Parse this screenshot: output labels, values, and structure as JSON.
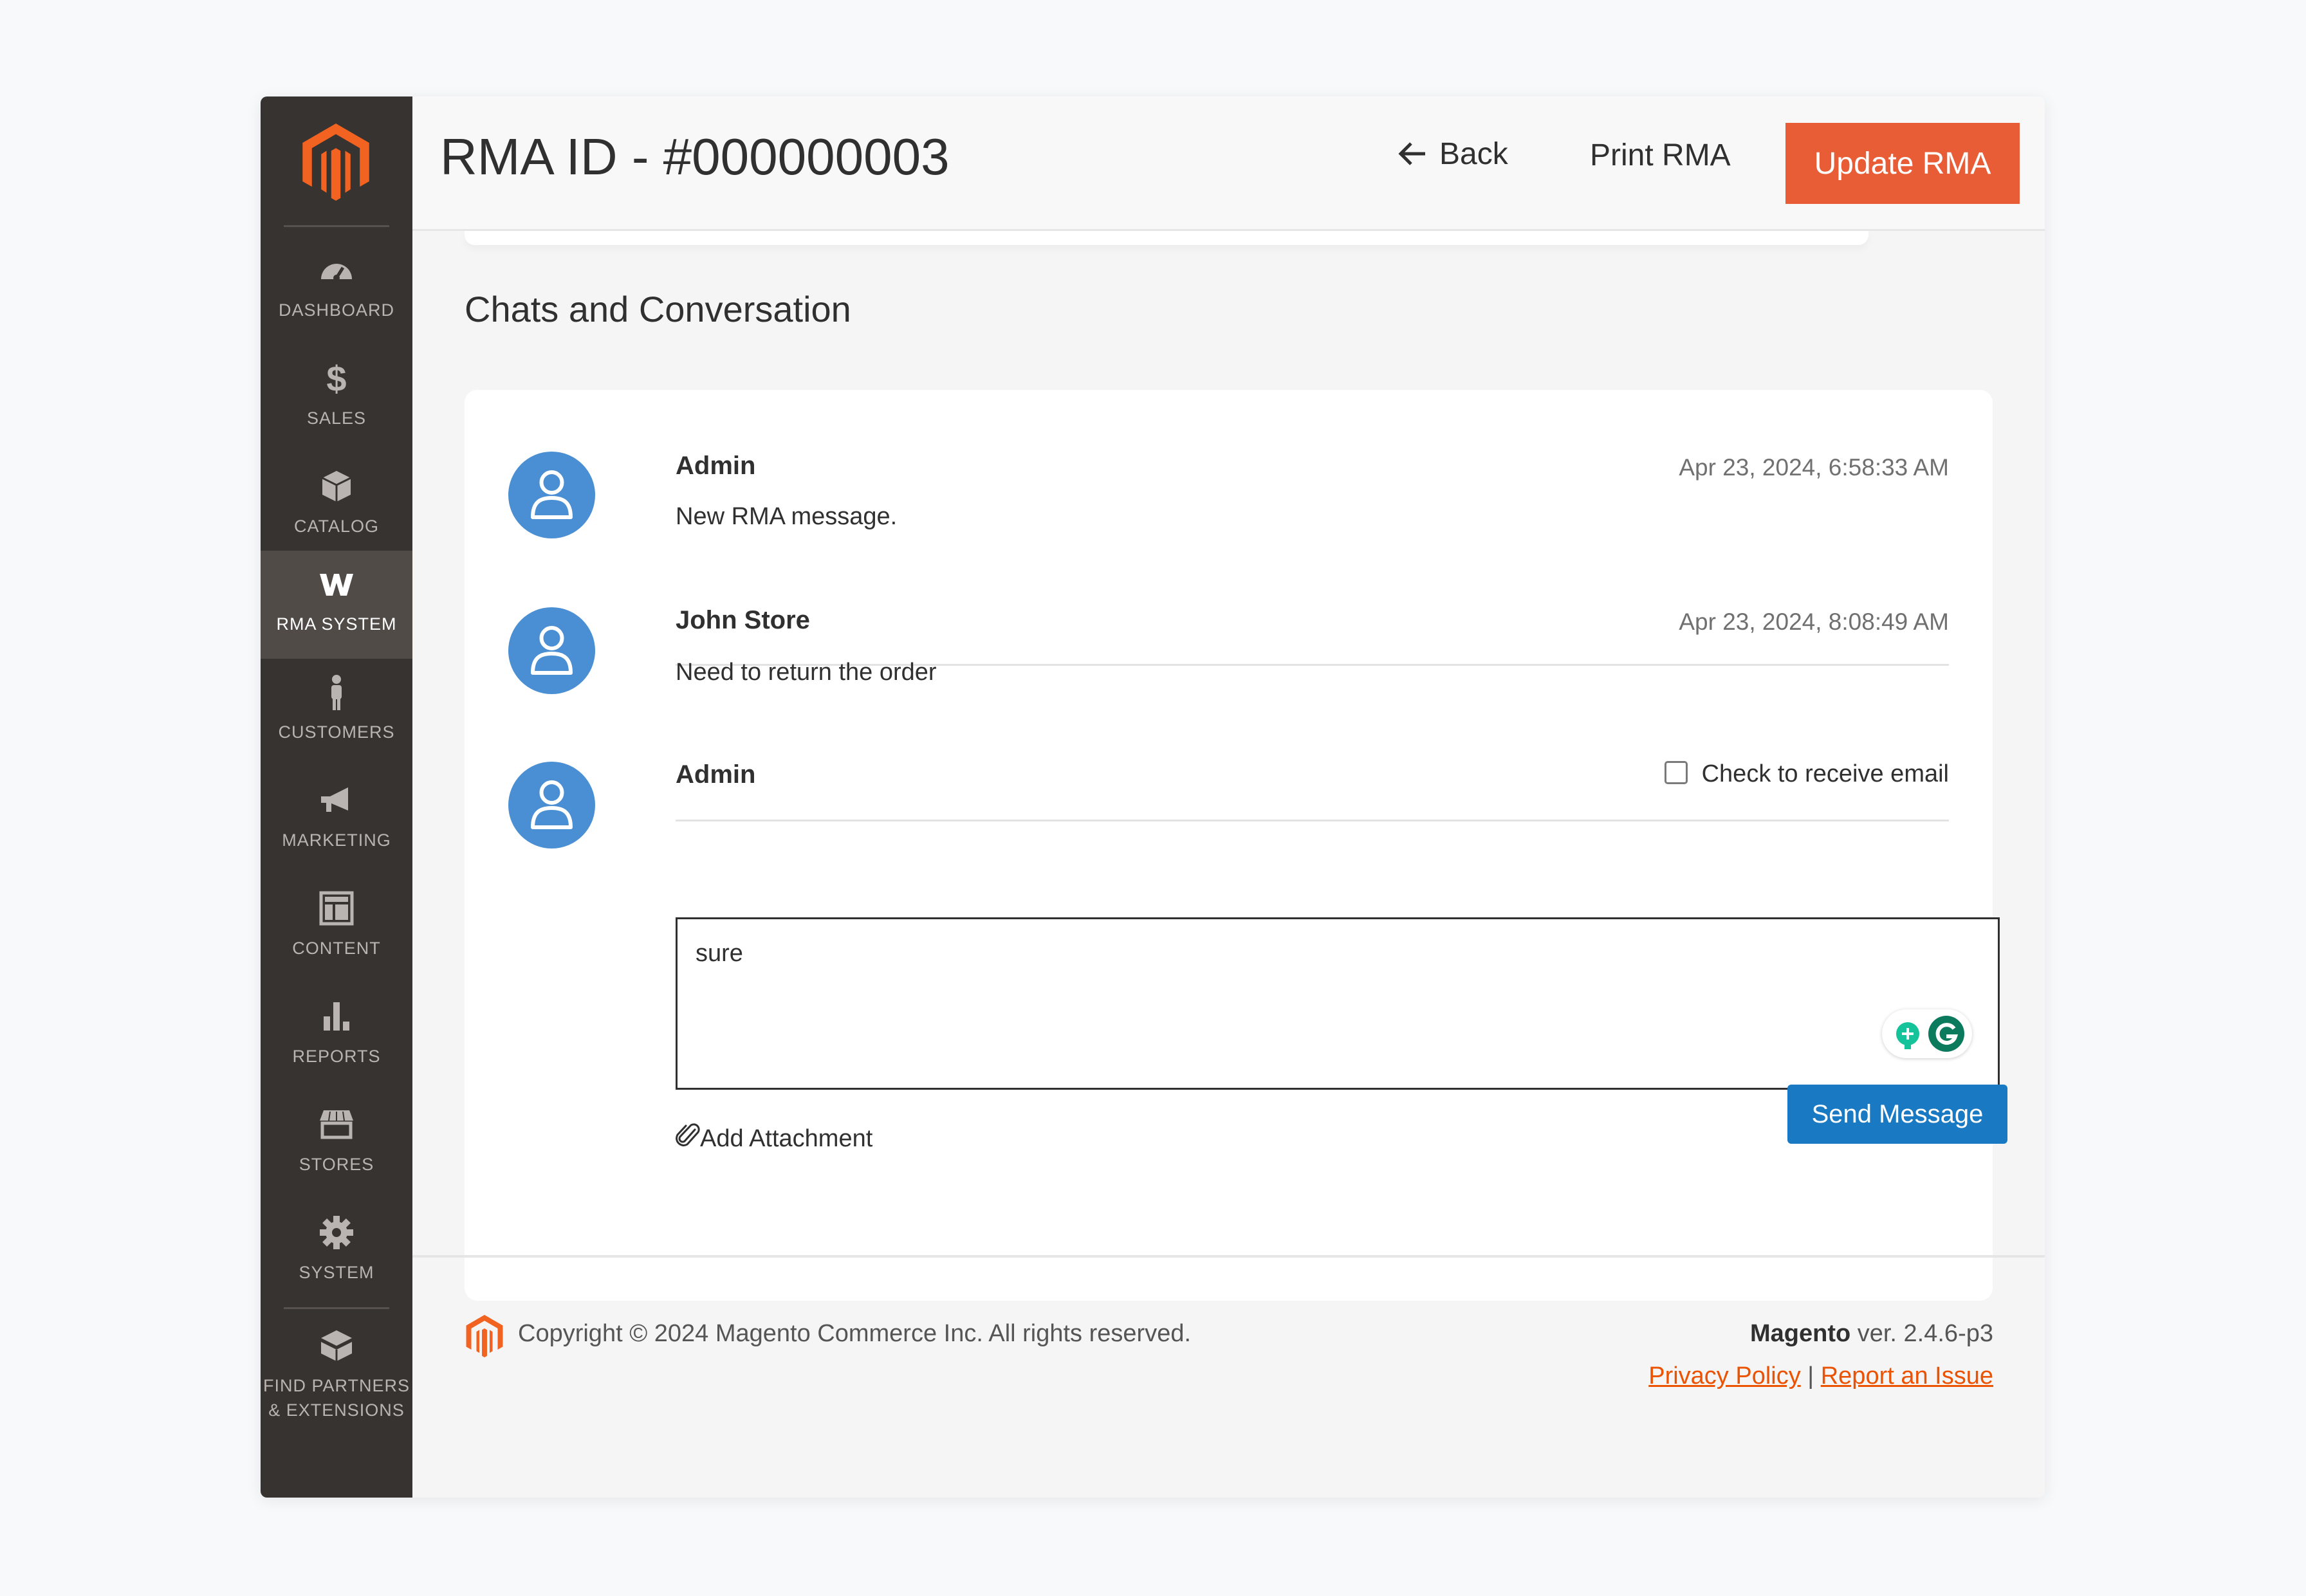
{
  "header": {
    "title": "RMA ID - #000000003",
    "back_label": "Back",
    "print_label": "Print RMA",
    "update_label": "Update RMA"
  },
  "sidebar": {
    "items": [
      {
        "label": "DASHBOARD",
        "icon": "dashboard-icon"
      },
      {
        "label": "SALES",
        "icon": "dollar-icon"
      },
      {
        "label": "CATALOG",
        "icon": "box-icon"
      },
      {
        "label": "RMA SYSTEM",
        "icon": "rma-icon",
        "active": true
      },
      {
        "label": "CUSTOMERS",
        "icon": "person-icon"
      },
      {
        "label": "MARKETING",
        "icon": "megaphone-icon"
      },
      {
        "label": "CONTENT",
        "icon": "layout-icon"
      },
      {
        "label": "REPORTS",
        "icon": "bar-chart-icon"
      },
      {
        "label": "STORES",
        "icon": "storefront-icon"
      },
      {
        "label": "SYSTEM",
        "icon": "gear-icon"
      },
      {
        "label_line1": "FIND PARTNERS",
        "label_line2": "& EXTENSIONS",
        "icon": "blocks-icon"
      }
    ]
  },
  "chat": {
    "section_title": "Chats and Conversation",
    "messages": [
      {
        "author": "Admin",
        "timestamp": "Apr 23, 2024, 6:58:33 AM",
        "text": "New RMA message."
      },
      {
        "author": "John Store",
        "timestamp": "Apr 23, 2024, 8:08:49 AM",
        "text": "Need to return the order"
      }
    ],
    "reply": {
      "author": "Admin",
      "email_checkbox_label": "Check to receive email",
      "email_checked": false,
      "value": "sure",
      "attach_label": "Add Attachment",
      "send_label": "Send Message"
    }
  },
  "footer": {
    "copyright": "Copyright © 2024 Magento Commerce Inc. All rights reserved.",
    "brand": "Magento",
    "version": " ver. 2.4.6-p3",
    "privacy_label": "Privacy Policy",
    "separator": " | ",
    "report_label": "Report an Issue"
  },
  "colors": {
    "accent": "#e85d35",
    "primary_button": "#1979c3",
    "sidebar": "#373330",
    "avatar": "#4a8fd3"
  }
}
